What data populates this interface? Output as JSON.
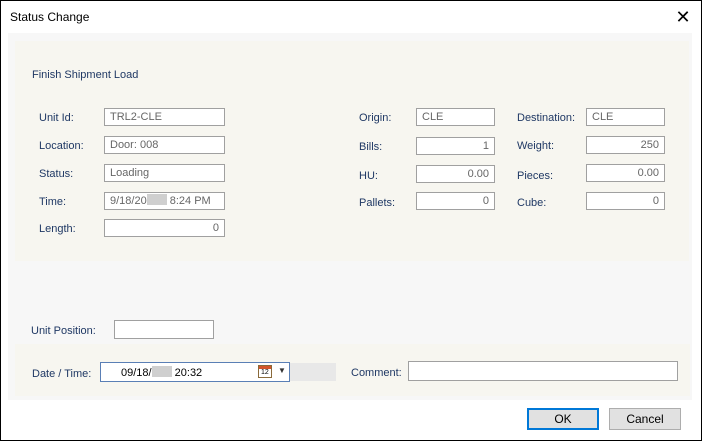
{
  "window": {
    "title": "Status Change",
    "close_glyph": "✕"
  },
  "section_title": "Finish Shipment Load",
  "left_fields": {
    "unit_id": {
      "label": "Unit Id:",
      "value": "TRL2-CLE"
    },
    "location": {
      "label": "Location:",
      "value": "Door: 008"
    },
    "status": {
      "label": "Status:",
      "value": "Loading"
    },
    "time": {
      "label": "Time:",
      "value_prefix": "9/18/20",
      "value_suffix": " 8:24 PM"
    },
    "length": {
      "label": "Length:",
      "value": "0"
    }
  },
  "mid_fields": {
    "origin": {
      "label": "Origin:",
      "value": "CLE"
    },
    "bills": {
      "label": "Bills:",
      "value": "1"
    },
    "hu": {
      "label": "HU:",
      "value": "0.00"
    },
    "pallets": {
      "label": "Pallets:",
      "value": "0"
    }
  },
  "right_fields": {
    "destination": {
      "label": "Destination:",
      "value": "CLE"
    },
    "weight": {
      "label": "Weight:",
      "value": "250"
    },
    "pieces": {
      "label": "Pieces:",
      "value": "0.00"
    },
    "cube": {
      "label": "Cube:",
      "value": "0"
    }
  },
  "unit_position": {
    "label": "Unit Position:",
    "value": ""
  },
  "date_time": {
    "label": "Date / Time:",
    "value_prefix": "09/18/",
    "value_suffix": " 20:32",
    "calendar_day": "12"
  },
  "comment": {
    "label": "Comment:",
    "value": ""
  },
  "buttons": {
    "ok": "OK",
    "cancel": "Cancel"
  }
}
